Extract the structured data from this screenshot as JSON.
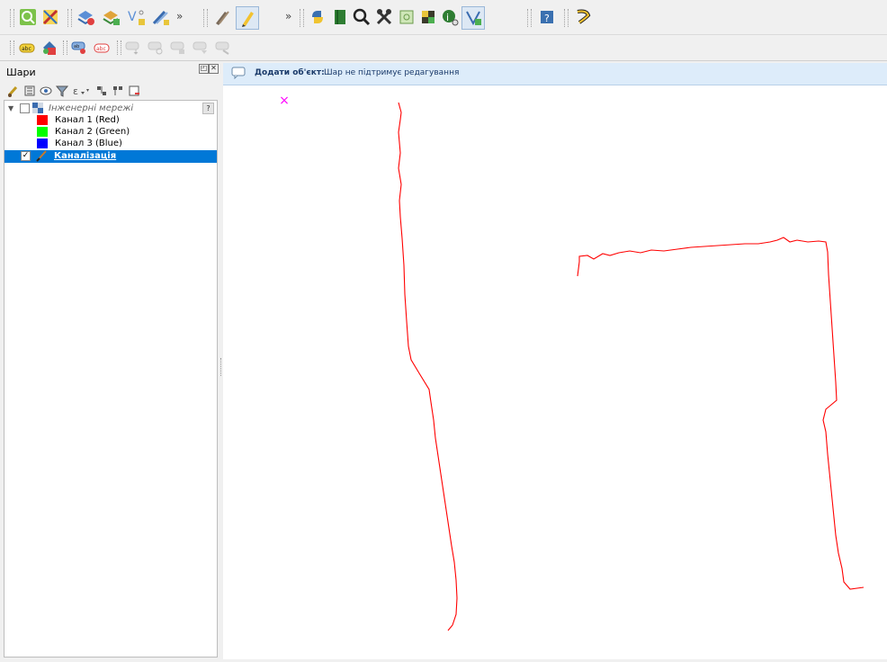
{
  "toolbar_main": {
    "overflow": "»",
    "buttons": [
      "zoom-to-layer-icon",
      "georeferencer-icon",
      "new-layer-icon",
      "add-layer-icon",
      "vector-tools-icon",
      "digitize-icon",
      "edit-pencil-icon",
      "toggle-edit-icon",
      "python-console-icon",
      "book-icon",
      "identify-icon",
      "tools-icon",
      "map-tips-icon",
      "dem-tools-icon",
      "identify-features-icon",
      "vertex-tool-icon",
      "help-icon",
      "plugin-icon"
    ]
  },
  "toolbar_labels": {
    "buttons": [
      "label-abc-icon",
      "label-color-icon",
      "pin-label-icon",
      "show-hide-label-icon",
      "move-label-icon",
      "rotate-label-icon",
      "change-label-icon",
      "diagram-label-icon",
      "label-options-icon"
    ]
  },
  "layers_panel": {
    "title": "Шари",
    "float_symbol": "◰",
    "close_symbol": "✕",
    "tools": [
      "style-brush-icon",
      "add-group-icon",
      "visibility-eye-icon",
      "filter-icon",
      "expression-filter-icon",
      "expand-all-icon",
      "collapse-all-icon",
      "remove-layer-icon"
    ],
    "tree": {
      "group": {
        "label": "Інженерні мережі",
        "checked": false,
        "expanded": true,
        "badge": "?"
      },
      "bands": [
        {
          "label": "Канал 1 (Red)",
          "color": "#ff0000"
        },
        {
          "label": "Канал 2 (Green)",
          "color": "#00ff00"
        },
        {
          "label": "Канал 3 (Blue)",
          "color": "#0000ff"
        }
      ],
      "layer": {
        "label": "Каналізація",
        "checked": true,
        "selected": true
      }
    }
  },
  "message_bar": {
    "title": "Додати об'єкт:",
    "text": "Шар не підтримує редагування"
  },
  "map": {
    "line_color": "#ff0000",
    "marker_color": "#ff00ff",
    "marker": "×"
  }
}
